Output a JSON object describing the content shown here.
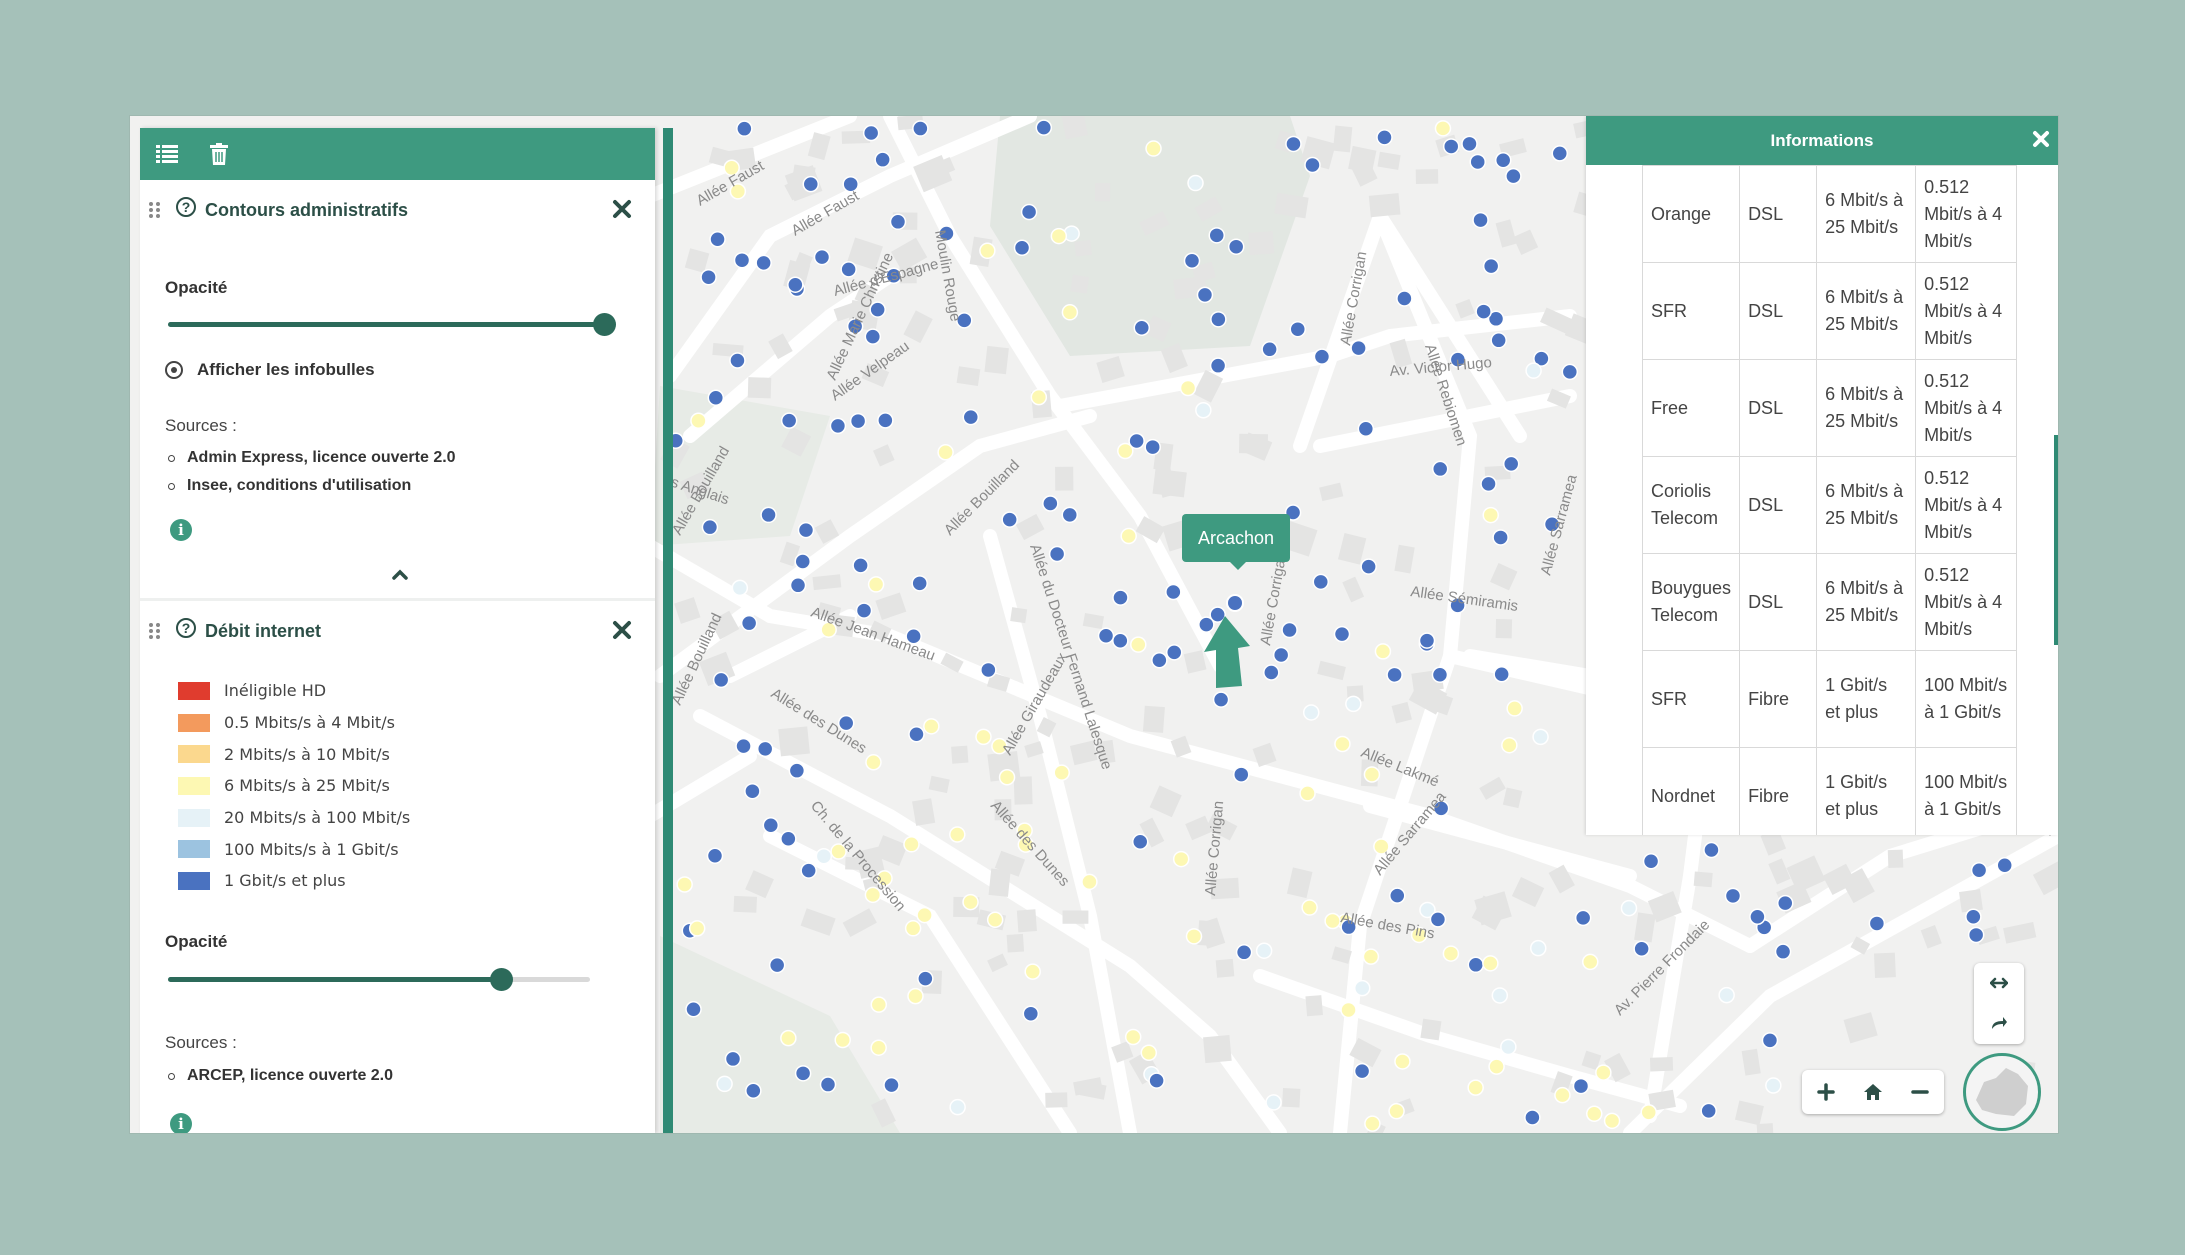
{
  "toolbar": {
    "list_icon": "list-icon",
    "trash_icon": "trash-icon"
  },
  "layers": [
    {
      "title": "Contours administratifs",
      "opacity_label": "Opacité",
      "opacity_value": 0.99,
      "tooltip_toggle_label": "Afficher les infobulles",
      "sources_label": "Sources :",
      "sources": [
        "Admin Express, licence ouverte 2.0",
        "Insee, conditions d'utilisation"
      ]
    },
    {
      "title": "Débit internet",
      "legend": [
        {
          "label": "Inéligible HD",
          "color": "#e03c2e"
        },
        {
          "label": "0.5 Mbits/s à 4 Mbit/s",
          "color": "#f39a5d"
        },
        {
          "label": "2 Mbits/s à 10 Mbit/s",
          "color": "#fbd88e"
        },
        {
          "label": "6 Mbits/s à 25 Mbit/s",
          "color": "#fdf8b3"
        },
        {
          "label": "20 Mbits/s à 100 Mbit/s",
          "color": "#e6f2f7"
        },
        {
          "label": "100 Mbits/s à 1 Gbit/s",
          "color": "#9cc3e0"
        },
        {
          "label": "1 Gbit/s et plus",
          "color": "#4a72c0"
        }
      ],
      "opacity_label": "Opacité",
      "opacity_value": 0.79,
      "sources_label": "Sources :",
      "sources": [
        "ARCEP, licence ouverte 2.0"
      ]
    }
  ],
  "tooltip": {
    "label": "Arcachon"
  },
  "info_panel": {
    "title": "Informations",
    "rows": [
      [
        "Orange",
        "DSL",
        "6 Mbit/s à 25 Mbit/s",
        "0.512 Mbit/s à 4 Mbit/s"
      ],
      [
        "SFR",
        "DSL",
        "6 Mbit/s à 25 Mbit/s",
        "0.512 Mbit/s à 4 Mbit/s"
      ],
      [
        "Free",
        "DSL",
        "6 Mbit/s à 25 Mbit/s",
        "0.512 Mbit/s à 4 Mbit/s"
      ],
      [
        "Coriolis Telecom",
        "DSL",
        "6 Mbit/s à 25 Mbit/s",
        "0.512 Mbit/s à 4 Mbit/s"
      ],
      [
        "Bouygues Telecom",
        "DSL",
        "6 Mbit/s à 25 Mbit/s",
        "0.512 Mbit/s à 4 Mbit/s"
      ],
      [
        "SFR",
        "Fibre",
        "1 Gbit/s et plus",
        "100 Mbit/s à 1 Gbit/s"
      ],
      [
        "Nordnet",
        "Fibre",
        "1 Gbit/s et plus",
        "100 Mbit/s à 1 Gbit/s"
      ]
    ]
  },
  "streets": [
    "Allée Faust",
    "Allée Faust",
    "Moulin Rouge",
    "Allée Marie Christine",
    "Allée d'Espagne",
    "Allée Velpeau",
    "Allée Corrigan",
    "Allée Rebiomen",
    "Av. Victor Hugo",
    "Allée Bouilland",
    "Allée Bouilland",
    "s Anglais",
    "Allée du Docteur Fernand Lalesque",
    "Allée Jean Hameau",
    "Allée Corrigan",
    "Allée Sémiramis",
    "Allée Sarramea",
    "Allée Giraudeaux",
    "Allée des Dunes",
    "Allée des Dunes",
    "Ch. de la Procession",
    "Allée Bouilland",
    "Allée Lakmé",
    "Allée Corrigan",
    "Allée Sarramea",
    "Allée des Pins",
    "Av. Pierre Frondaie",
    "Allée"
  ],
  "colors": {
    "accent": "#3e9a80",
    "dark": "#2c4f47",
    "dot_blue": "#4a72c0",
    "dot_yellow": "#fdf8b3",
    "dot_lightblue": "#e6f2f7"
  },
  "map_controls": [
    "zoom-in-icon",
    "home-icon",
    "zoom-out-icon",
    "expand-horizontal-icon",
    "share-arrow-icon"
  ]
}
